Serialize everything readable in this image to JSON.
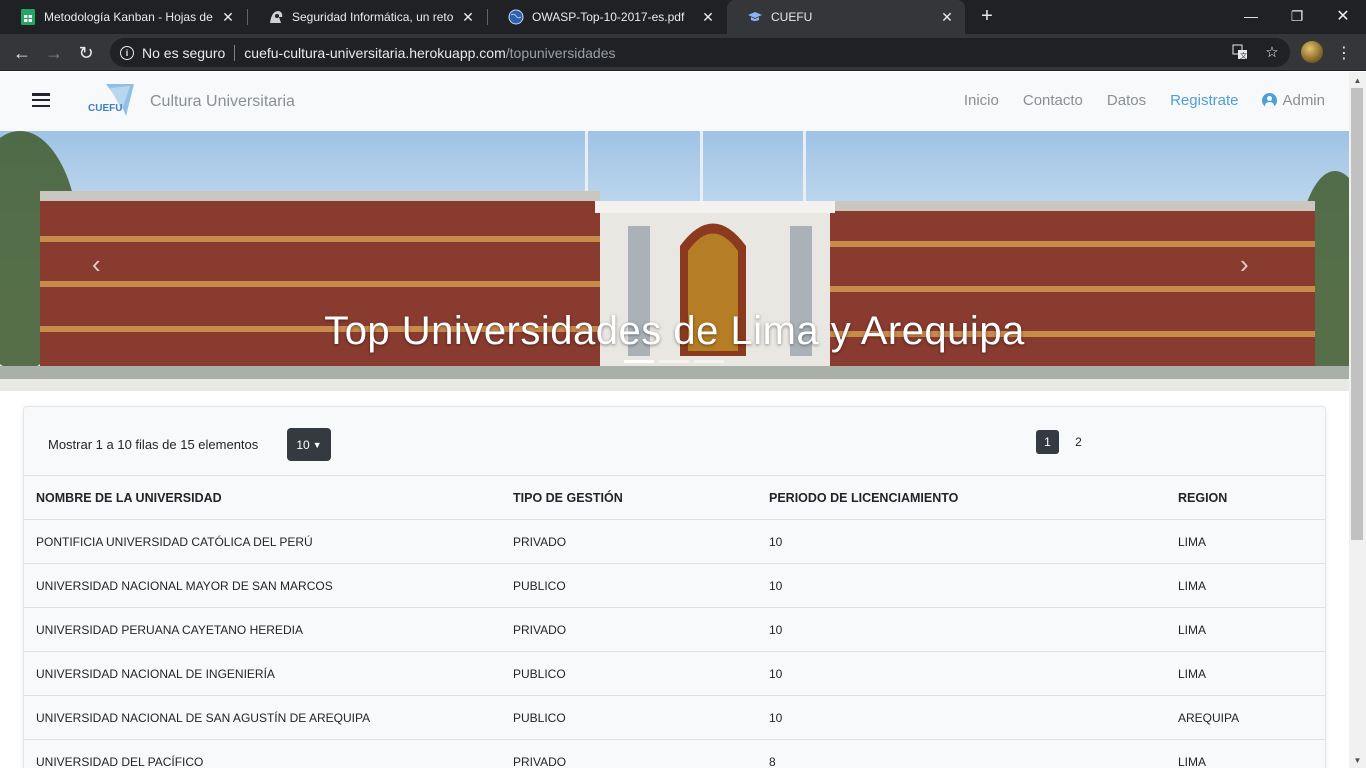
{
  "browser": {
    "tabs": [
      {
        "title": "Metodología Kanban - Hojas de c",
        "active": false,
        "icon": "sheets-icon"
      },
      {
        "title": "Seguridad Informática, un reto p",
        "active": false,
        "icon": "hacker-icon"
      },
      {
        "title": "OWASP-Top-10-2017-es.pdf",
        "active": false,
        "icon": "globe-icon"
      },
      {
        "title": "CUEFU",
        "active": true,
        "icon": "graduation-cap-icon"
      }
    ],
    "security_label": "No es seguro",
    "url_host": "cuefu-cultura-universitaria.herokuapp.com",
    "url_path": "/topuniversidades"
  },
  "site": {
    "logo_text": "CUEFU",
    "brand": "Cultura Universitaria",
    "nav": {
      "inicio": "Inicio",
      "contacto": "Contacto",
      "datos": "Datos",
      "registrate": "Registrate",
      "admin": "Admin"
    },
    "hero_title": "Top Universidades de Lima y Arequipa"
  },
  "table_controls": {
    "showing": "Mostrar 1 a 10 filas de 15 elementos",
    "page_size": "10",
    "pages": [
      "1",
      "2"
    ],
    "current_page": "1"
  },
  "table": {
    "headers": [
      "NOMBRE DE LA UNIVERSIDAD",
      "TIPO DE GESTIÓN",
      "PERIODO DE LICENCIAMIENTO",
      "REGION"
    ],
    "rows": [
      [
        "PONTIFICIA UNIVERSIDAD CATÓLICA DEL PERÚ",
        "PRIVADO",
        "10",
        "LIMA"
      ],
      [
        "UNIVERSIDAD NACIONAL MAYOR DE SAN MARCOS",
        "PUBLICO",
        "10",
        "LIMA"
      ],
      [
        "UNIVERSIDAD PERUANA CAYETANO HEREDIA",
        "PRIVADO",
        "10",
        "LIMA"
      ],
      [
        "UNIVERSIDAD NACIONAL DE INGENIERÍA",
        "PUBLICO",
        "10",
        "LIMA"
      ],
      [
        "UNIVERSIDAD NACIONAL DE SAN AGUSTÍN DE AREQUIPA",
        "PUBLICO",
        "10",
        "AREQUIPA"
      ],
      [
        "UNIVERSIDAD DEL PACÍFICO",
        "PRIVADO",
        "8",
        "LIMA"
      ]
    ]
  },
  "colors": {
    "browser_dark": "#202124",
    "toolbar": "#35363a",
    "nav_bg": "#f8f9fa",
    "link_blue": "#4d9fd6",
    "dark_button": "#343a40"
  }
}
